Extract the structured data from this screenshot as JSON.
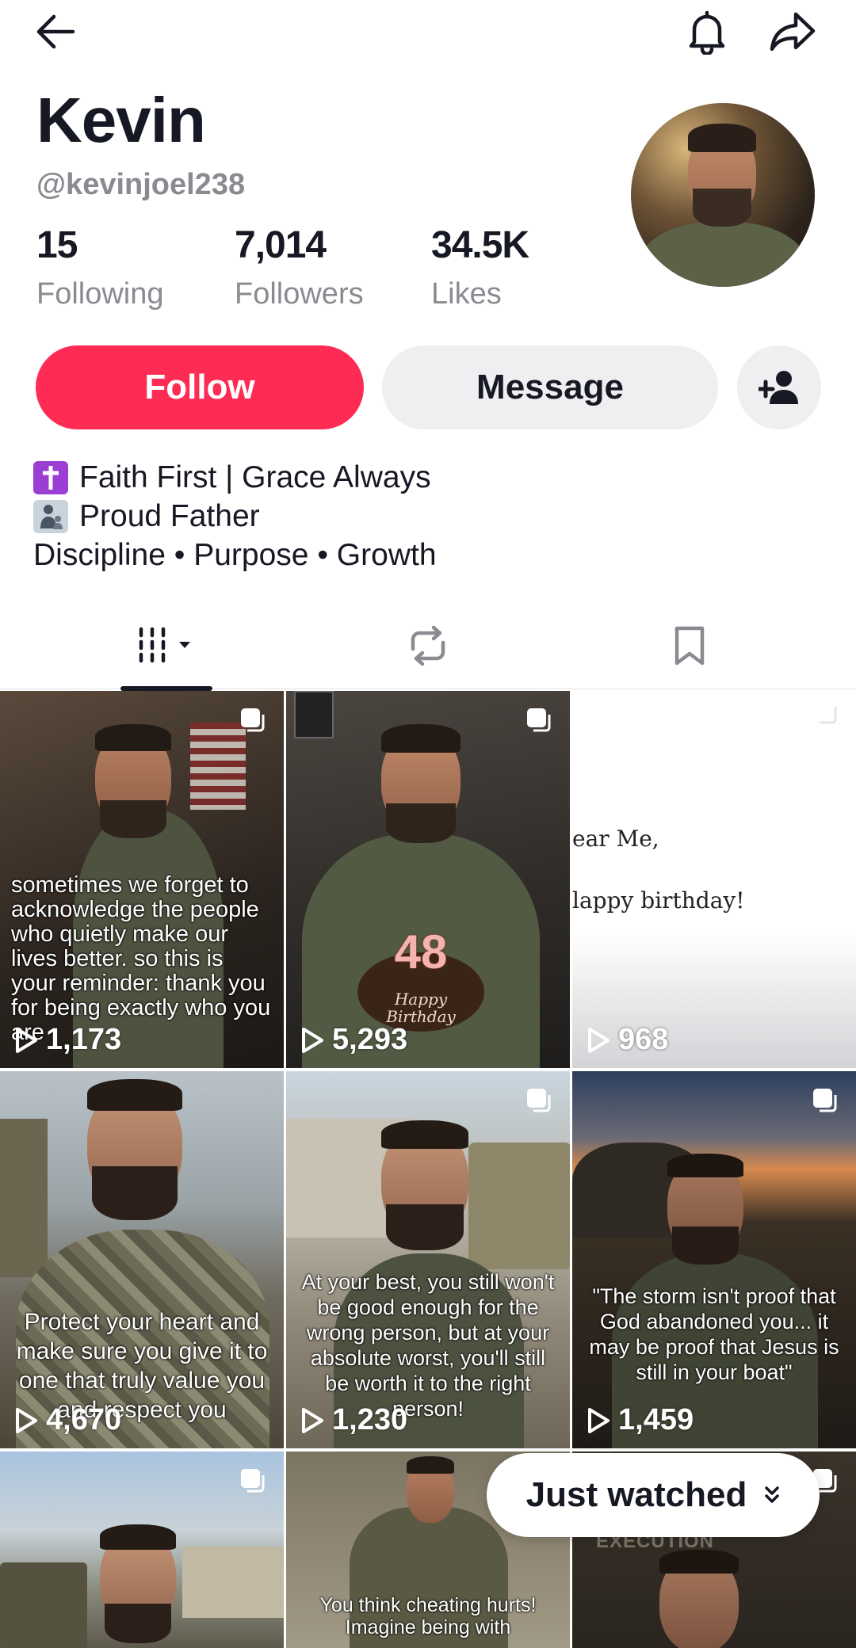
{
  "profile": {
    "name": "Kevin",
    "handle": "@kevinjoel238",
    "stats": [
      {
        "value": "15",
        "label": "Following"
      },
      {
        "value": "7,014",
        "label": "Followers"
      },
      {
        "value": "34.5K",
        "label": "Likes"
      }
    ]
  },
  "actions": {
    "follow_label": "Follow",
    "message_label": "Message"
  },
  "bio": {
    "line1": "Faith First | Grace Always",
    "line2": "Proud Father",
    "line3": "Discipline • Purpose • Growth"
  },
  "tabs": [
    {
      "icon": "videos-grid-icon"
    },
    {
      "icon": "repost-icon"
    },
    {
      "icon": "bookmark-icon"
    }
  ],
  "videos": [
    {
      "caption": "sometimes we forget to acknowledge the people who quietly make our lives better. so this is your reminder: thank you for being exactly who you are",
      "views": "1,173"
    },
    {
      "caption": "",
      "cake_number": "48",
      "cake_text": "Happy Birthday",
      "views": "5,293"
    },
    {
      "caption": "",
      "letter_line1": "ear Me,",
      "letter_line2": "lappy birthday!",
      "views": "968"
    },
    {
      "caption": "Protect your heart and make sure you give it to one that truly value you and respect you",
      "views": "4,670"
    },
    {
      "caption": "At your best, you still won't be good enough for the wrong person, but at your absolute worst, you'll still be worth it to the right person!",
      "views": "1,230"
    },
    {
      "caption": "\"The storm isn't proof that God abandoned you... it may be proof that Jesus is still in your boat\"",
      "views": "1,459"
    },
    {
      "caption": ""
    },
    {
      "caption": "You think cheating hurts! Imagine being with"
    },
    {
      "caption": "",
      "sign_text": "EXECUTION"
    }
  ],
  "just_watched_label": "Just watched",
  "colors": {
    "accent": "#fe2c55",
    "secondary_button": "#efeff1",
    "muted_text": "#8a8b91"
  }
}
